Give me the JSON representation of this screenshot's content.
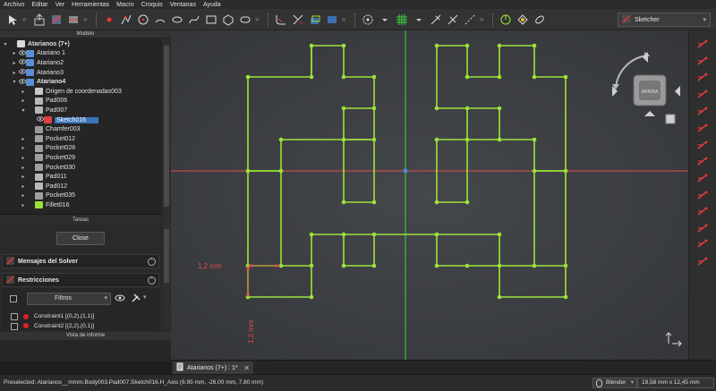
{
  "menu": [
    "Archivo",
    "Editar",
    "Ver",
    "Herramientas",
    "Macro",
    "Croquis",
    "Ventanas",
    "Ayuda"
  ],
  "workbench": {
    "label": "Sketcher",
    "icon": "sketcher-icon"
  },
  "model_panel": {
    "title": "Modelo"
  },
  "tree": [
    {
      "label": "Atarianos (7+)",
      "level": 0,
      "bold": true,
      "arrow": "expanded",
      "icon": "document-icon"
    },
    {
      "label": "Atariano 1",
      "level": 1,
      "arrow": "collapsed",
      "eye": true,
      "icon": "body-icon"
    },
    {
      "label": "Atariano2",
      "level": 1,
      "arrow": "collapsed",
      "eye": true,
      "icon": "body-icon"
    },
    {
      "label": "Atariano3",
      "level": 1,
      "arrow": "collapsed",
      "eye": true,
      "icon": "body-icon"
    },
    {
      "label": "Atariano4",
      "level": 1,
      "bold": true,
      "arrow": "expanded",
      "eye": true,
      "icon": "body-icon"
    },
    {
      "label": "Origen de coordenadas003",
      "level": 2,
      "arrow": "collapsed",
      "icon": "origin-icon"
    },
    {
      "label": "Pad006",
      "level": 2,
      "arrow": "collapsed",
      "icon": "pad-icon"
    },
    {
      "label": "Pad007",
      "level": 2,
      "arrow": "expanded",
      "icon": "pad-icon"
    },
    {
      "label": "Sketch016",
      "level": 3,
      "selected": true,
      "eye": true,
      "icon": "sketch-icon"
    },
    {
      "label": "Chamfer003",
      "level": 2,
      "icon": "chamfer-icon"
    },
    {
      "label": "Pocket012",
      "level": 2,
      "arrow": "collapsed",
      "icon": "pocket-icon"
    },
    {
      "label": "Pocket028",
      "level": 2,
      "arrow": "collapsed",
      "icon": "pocket-icon"
    },
    {
      "label": "Pocket029",
      "level": 2,
      "arrow": "collapsed",
      "icon": "pocket-icon"
    },
    {
      "label": "Pocket030",
      "level": 2,
      "arrow": "collapsed",
      "icon": "pocket-icon"
    },
    {
      "label": "Pad011",
      "level": 2,
      "arrow": "collapsed",
      "icon": "pad-icon"
    },
    {
      "label": "Pad012",
      "level": 2,
      "arrow": "collapsed",
      "icon": "pad-icon"
    },
    {
      "label": "Pocket035",
      "level": 2,
      "arrow": "collapsed",
      "icon": "pocket-icon"
    },
    {
      "label": "Fillet016",
      "level": 2,
      "arrow": "collapsed",
      "icon": "fillet-icon"
    }
  ],
  "tasks": {
    "title": "Tareas",
    "close_label": "Close"
  },
  "solver": {
    "title": "Mensajes del Solver"
  },
  "constraints": {
    "title": "Restricciones",
    "filter_label": "Filtros",
    "items": [
      "Constraint1 [(0,2),(1,1)]",
      "Constraint2 [(2,2),(0,1)]"
    ]
  },
  "report": {
    "title": "Vista de informe"
  },
  "viewport": {
    "navcube_face": "ARRIBA",
    "dimension_horizontal": "1,2 mm",
    "dimension_vertical": "1,2 mm"
  },
  "tab": {
    "label": "Atarianos (7+) : 1*"
  },
  "status": {
    "message": "Preselected: Atarianos__mmm.Body003.Pad007.Sketch016.H_Axis (6.95 mm, -26.00 mm, 7.80 mm)",
    "nav_style": "Blender",
    "dimensions": "19,58 mm x 12,45 mm"
  },
  "colors": {
    "geometry": "#9de23a",
    "x_axis": "#e05050",
    "y_axis": "#40d040",
    "background": "#3c3e41",
    "dimension": "#e04a4a",
    "selection": "#3b74b8"
  }
}
